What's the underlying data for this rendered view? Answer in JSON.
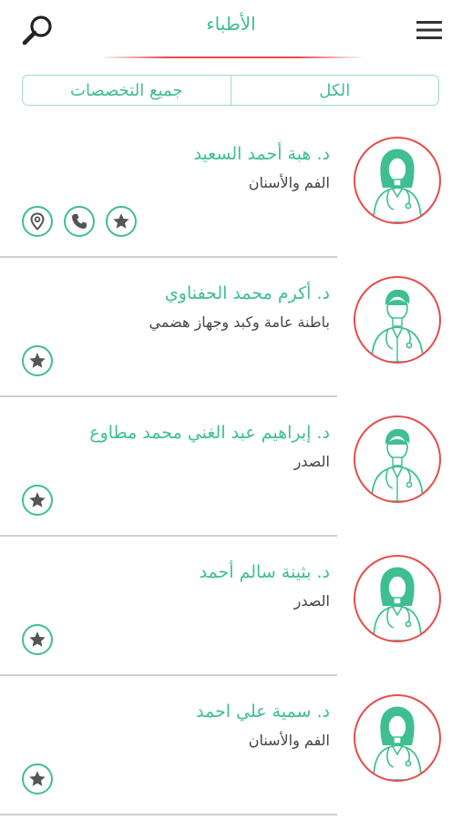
{
  "header": {
    "title": "الأطباء",
    "search_icon": "search-icon",
    "menu_icon": "hamburger-menu-icon"
  },
  "filters": {
    "all_label": "الكل",
    "specialties_label": "جميع التخصصات"
  },
  "colors": {
    "accent": "#3fbf8f",
    "ring": "#e84c4c",
    "text": "#444444",
    "divider": "#cfcfcf"
  },
  "doctors": [
    {
      "name": "د. هبة أحمد السعيد",
      "specialty": "الفم والأسنان",
      "gender": "female",
      "actions": [
        "location-icon",
        "phone-icon",
        "star-icon"
      ]
    },
    {
      "name": "د. أكرم محمد الحفناوي",
      "specialty": "باطنة عامة وكبد وجهاز هضمي",
      "gender": "male",
      "actions": [
        "star-icon"
      ]
    },
    {
      "name": "د. إبراهيم عبد الغني محمد مطاوع",
      "specialty": "الصدر",
      "gender": "male",
      "actions": [
        "star-icon"
      ]
    },
    {
      "name": "د. بثينة سالم أحمد",
      "specialty": "الصدر",
      "gender": "female",
      "actions": [
        "star-icon"
      ]
    },
    {
      "name": "د. سمية علي احمد",
      "specialty": "الفم والأسنان",
      "gender": "female",
      "actions": [
        "star-icon"
      ]
    }
  ]
}
